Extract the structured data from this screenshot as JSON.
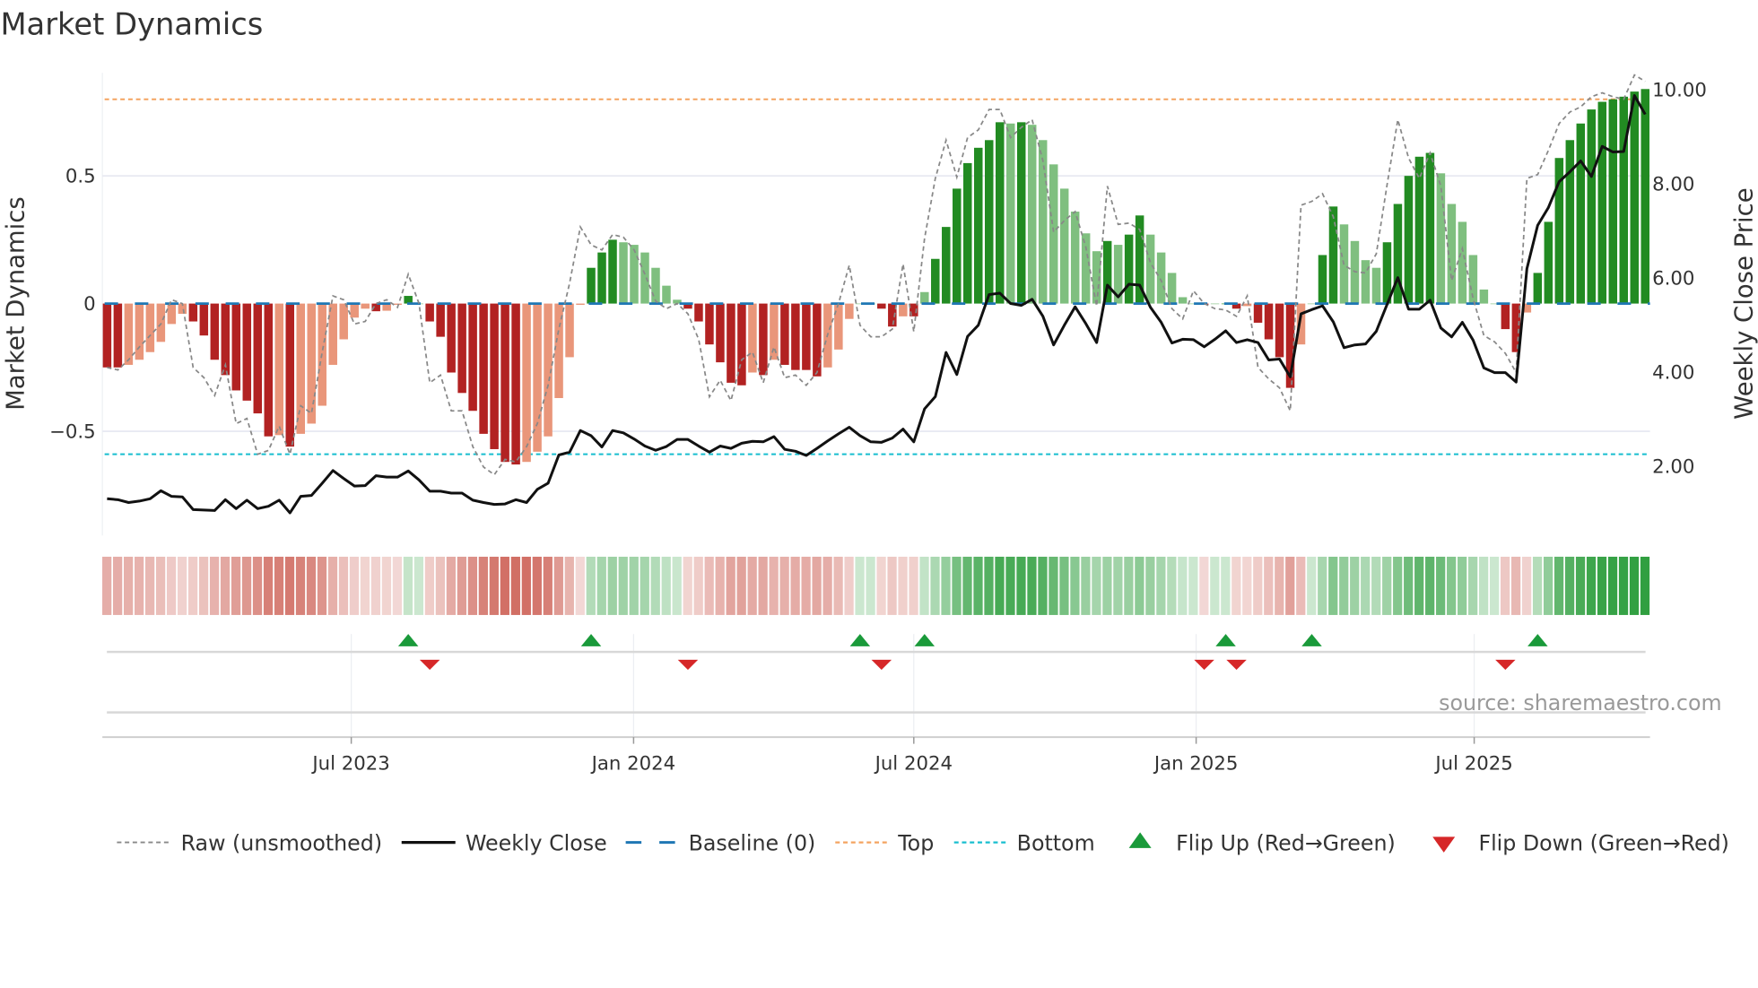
{
  "title": "Market Dynamics",
  "source": "source: sharemaestro.com",
  "colors": {
    "dark_red": "#b22222",
    "light_red": "#e9967a",
    "dark_green": "#228b22",
    "light_green": "#7fbf7f",
    "baseline": "#1f77b4",
    "top": "#f4a460",
    "bottom": "#17becf",
    "flip_up": "#1a9a3a",
    "flip_down": "#d62728",
    "raw": "#888888",
    "close": "#111111"
  },
  "chart_data": {
    "type": "bar",
    "title": "Market Dynamics",
    "x_start": "2023-01-20",
    "x_frequency": "weekly",
    "ylabel": "Market Dynamics",
    "y2label": "Weekly Close Price",
    "ylim": [
      -0.91,
      0.95
    ],
    "y2lim": [
      0.24,
      10.57
    ],
    "yticks": [
      {
        "v": 0.5,
        "label": "0.5"
      },
      {
        "v": 0,
        "label": "0"
      },
      {
        "v": -0.5,
        "label": "−0.5"
      }
    ],
    "y2ticks": [
      {
        "v": 10,
        "label": "10.00"
      },
      {
        "v": 8,
        "label": "8.00"
      },
      {
        "v": 6,
        "label": "6.00"
      },
      {
        "v": 4,
        "label": "4.00"
      },
      {
        "v": 2,
        "label": "2.00"
      }
    ],
    "xticks": [
      {
        "week": 22.7,
        "label": "Jul 2023"
      },
      {
        "week": 48.95,
        "label": "Jan 2024"
      },
      {
        "week": 75.0,
        "label": "Jul 2024"
      },
      {
        "week": 101.25,
        "label": "Jan 2025"
      },
      {
        "week": 127.1,
        "label": "Jul 2025"
      }
    ],
    "top_level": 0.8,
    "bottom_level": -0.59,
    "baseline": 0,
    "series": [
      {
        "name": "Market Dynamics",
        "type": "bar",
        "values": [
          -0.25,
          -0.25,
          -0.24,
          -0.22,
          -0.19,
          -0.15,
          -0.08,
          -0.04,
          -0.07,
          -0.125,
          -0.22,
          -0.28,
          -0.34,
          -0.38,
          -0.43,
          -0.52,
          -0.515,
          -0.56,
          -0.51,
          -0.47,
          -0.4,
          -0.24,
          -0.14,
          -0.055,
          -0.02,
          -0.03,
          -0.028,
          -0.005,
          0.03,
          0.0,
          -0.07,
          -0.13,
          -0.27,
          -0.35,
          -0.42,
          -0.51,
          -0.57,
          -0.62,
          -0.63,
          -0.62,
          -0.58,
          -0.52,
          -0.37,
          -0.21,
          -0.005,
          0.14,
          0.2,
          0.25,
          0.24,
          0.23,
          0.2,
          0.14,
          0.07,
          0.015,
          -0.02,
          -0.07,
          -0.16,
          -0.23,
          -0.31,
          -0.32,
          -0.27,
          -0.28,
          -0.22,
          -0.24,
          -0.26,
          -0.26,
          -0.285,
          -0.25,
          -0.18,
          -0.06,
          0.0,
          0.0,
          -0.02,
          -0.09,
          -0.05,
          -0.05,
          0.045,
          0.175,
          0.3,
          0.45,
          0.55,
          0.61,
          0.64,
          0.71,
          0.705,
          0.71,
          0.7,
          0.64,
          0.545,
          0.45,
          0.36,
          0.275,
          0.205,
          0.245,
          0.23,
          0.27,
          0.345,
          0.27,
          0.2,
          0.12,
          0.025,
          0.0,
          -0.005,
          0.0,
          0.0,
          -0.02,
          -0.01,
          -0.075,
          -0.14,
          -0.21,
          -0.33,
          -0.16,
          0.0,
          0.19,
          0.38,
          0.31,
          0.245,
          0.17,
          0.14,
          0.24,
          0.39,
          0.5,
          0.575,
          0.59,
          0.51,
          0.39,
          0.32,
          0.19,
          0.055,
          0.0,
          -0.1,
          -0.19,
          -0.035,
          0.12,
          0.32,
          0.57,
          0.64,
          0.705,
          0.76,
          0.79,
          0.8,
          0.81,
          0.83,
          0.84
        ]
      },
      {
        "name": "Raw (unsmoothed)",
        "type": "line",
        "values": [
          -0.25,
          -0.26,
          -0.22,
          -0.17,
          -0.125,
          -0.08,
          0.015,
          0.0,
          -0.25,
          -0.29,
          -0.36,
          -0.24,
          -0.47,
          -0.45,
          -0.59,
          -0.575,
          -0.48,
          -0.59,
          -0.4,
          -0.43,
          -0.19,
          0.03,
          0.015,
          -0.08,
          -0.07,
          0.0,
          0.015,
          -0.015,
          0.115,
          0.0,
          -0.31,
          -0.28,
          -0.42,
          -0.42,
          -0.56,
          -0.64,
          -0.67,
          -0.61,
          -0.62,
          -0.56,
          -0.47,
          -0.32,
          -0.1,
          0.08,
          0.3,
          0.23,
          0.21,
          0.27,
          0.26,
          0.21,
          0.115,
          0.01,
          -0.02,
          0.0,
          -0.04,
          -0.14,
          -0.365,
          -0.3,
          -0.38,
          -0.22,
          -0.19,
          -0.31,
          -0.17,
          -0.29,
          -0.28,
          -0.32,
          -0.27,
          -0.12,
          0.0,
          0.15,
          -0.085,
          -0.13,
          -0.13,
          -0.1,
          0.155,
          -0.11,
          0.255,
          0.49,
          0.64,
          0.495,
          0.65,
          0.68,
          0.76,
          0.76,
          0.65,
          0.69,
          0.72,
          0.56,
          0.28,
          0.325,
          0.36,
          0.22,
          -0.01,
          0.46,
          0.31,
          0.315,
          0.29,
          0.16,
          0.09,
          -0.02,
          -0.06,
          0.05,
          0.0,
          -0.02,
          -0.025,
          -0.05,
          0.03,
          -0.25,
          -0.295,
          -0.33,
          -0.42,
          0.385,
          0.4,
          0.43,
          0.34,
          0.15,
          0.125,
          0.12,
          0.195,
          0.465,
          0.72,
          0.57,
          0.49,
          0.59,
          0.46,
          0.09,
          0.215,
          0.02,
          -0.125,
          -0.15,
          -0.195,
          -0.27,
          0.49,
          0.505,
          0.6,
          0.705,
          0.75,
          0.77,
          0.81,
          0.825,
          0.81,
          0.8,
          0.895,
          0.87
        ]
      },
      {
        "name": "Weekly Close",
        "type": "line",
        "axis": "right",
        "values": [
          1.28,
          1.26,
          1.2,
          1.23,
          1.28,
          1.45,
          1.33,
          1.32,
          1.05,
          1.04,
          1.03,
          1.26,
          1.07,
          1.25,
          1.07,
          1.12,
          1.25,
          0.98,
          1.33,
          1.35,
          1.61,
          1.88,
          1.71,
          1.55,
          1.56,
          1.77,
          1.74,
          1.74,
          1.87,
          1.68,
          1.44,
          1.44,
          1.4,
          1.4,
          1.25,
          1.2,
          1.16,
          1.17,
          1.26,
          1.2,
          1.48,
          1.61,
          2.21,
          2.27,
          2.73,
          2.62,
          2.38,
          2.73,
          2.68,
          2.55,
          2.4,
          2.31,
          2.39,
          2.54,
          2.54,
          2.4,
          2.27,
          2.4,
          2.35,
          2.46,
          2.5,
          2.49,
          2.6,
          2.33,
          2.29,
          2.2,
          2.35,
          2.51,
          2.66,
          2.8,
          2.62,
          2.49,
          2.48,
          2.57,
          2.76,
          2.49,
          3.19,
          3.45,
          4.39,
          3.92,
          4.73,
          4.97,
          5.62,
          5.65,
          5.43,
          5.39,
          5.52,
          5.16,
          4.55,
          4.97,
          5.36,
          5.0,
          4.6,
          5.82,
          5.57,
          5.84,
          5.82,
          5.35,
          5.03,
          4.59,
          4.67,
          4.66,
          4.51,
          4.67,
          4.85,
          4.6,
          4.66,
          4.6,
          4.23,
          4.25,
          3.87,
          5.21,
          5.3,
          5.38,
          5.04,
          4.49,
          4.55,
          4.57,
          4.84,
          5.41,
          5.98,
          5.31,
          5.31,
          5.5,
          4.91,
          4.72,
          5.03,
          4.65,
          4.06,
          3.96,
          3.96,
          3.76,
          6.17,
          7.09,
          7.47,
          8.02,
          8.23,
          8.46,
          8.13,
          8.77,
          8.65,
          8.66,
          9.85,
          9.45
        ]
      }
    ],
    "flip_up_weeks": [
      28,
      45,
      70,
      76,
      104,
      112,
      133
    ],
    "flip_down_weeks": [
      30,
      54,
      72,
      102,
      105,
      130
    ],
    "legend": {
      "placement": "bottom",
      "items": [
        {
          "label": "Raw (unsmoothed)",
          "kind": "raw"
        },
        {
          "label": "Weekly Close",
          "kind": "close"
        },
        {
          "label": "Baseline (0)",
          "kind": "baseline"
        },
        {
          "label": "Top",
          "kind": "top"
        },
        {
          "label": "Bottom",
          "kind": "bottom"
        },
        {
          "label": "Flip Up (Red→Green)",
          "kind": "up"
        },
        {
          "label": "Flip Down (Green→Red)",
          "kind": "down"
        }
      ]
    }
  }
}
